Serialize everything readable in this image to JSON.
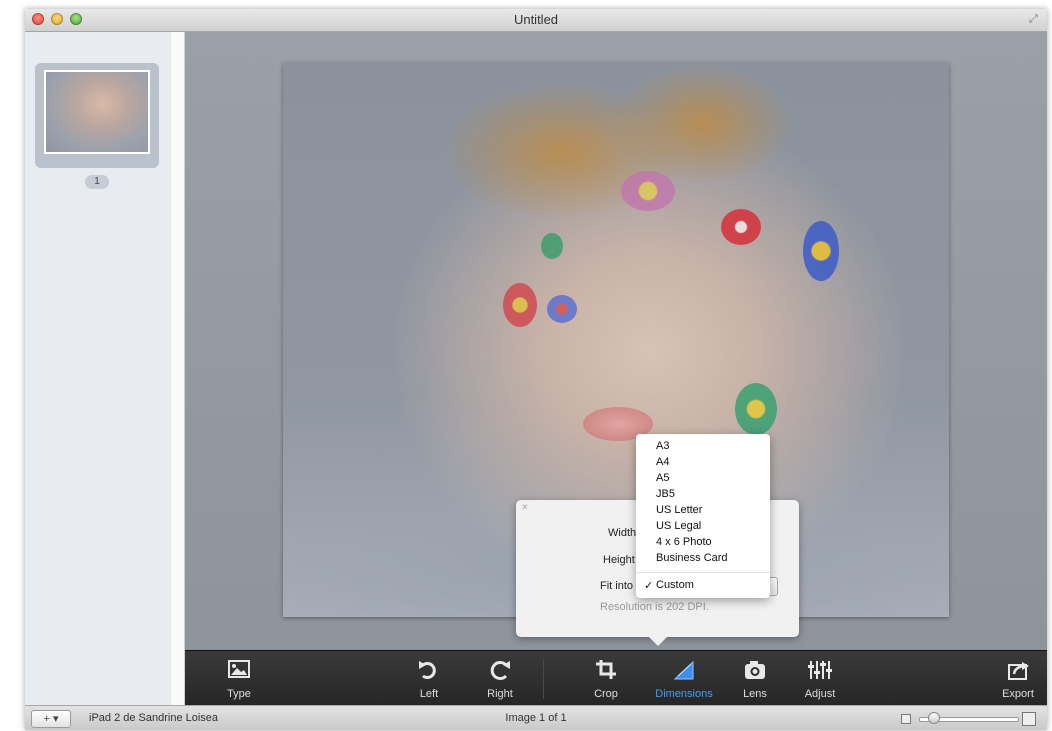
{
  "window": {
    "title": "Untitled",
    "fullscreen_glyph": "⤢"
  },
  "sidebar": {
    "thumbnail_number": "1"
  },
  "toolbar": {
    "items": [
      {
        "label": "Type",
        "icon": "photo-icon"
      },
      {
        "label": "Left",
        "icon": "rotate-left-icon"
      },
      {
        "label": "Right",
        "icon": "rotate-right-icon"
      },
      {
        "label": "Crop",
        "icon": "crop-icon"
      },
      {
        "label": "Dimensions",
        "icon": "dimensions-icon",
        "active": true
      },
      {
        "label": "Lens",
        "icon": "camera-icon"
      },
      {
        "label": "Adjust",
        "icon": "sliders-icon"
      },
      {
        "label": "Export",
        "icon": "export-icon"
      }
    ]
  },
  "popover": {
    "close_glyph": "×",
    "width_label": "Width",
    "height_label": "Height",
    "fit_into_label": "Fit into",
    "resolution_text": "Resolution is 202 DPI."
  },
  "fit_menu": {
    "items": [
      "A3",
      "A4",
      "A5",
      "JB5",
      "US Letter",
      "US Legal",
      "4 x 6 Photo",
      "Business Card"
    ],
    "selected": "Custom",
    "check": "✓"
  },
  "status": {
    "add_button": "+ ▾",
    "device": "iPad 2 de Sandrine Loisea",
    "image_count": "Image 1 of 1"
  },
  "colors": {
    "active_accent": "#4a9bf0",
    "toolbar_bg": "#2e2e2e"
  }
}
